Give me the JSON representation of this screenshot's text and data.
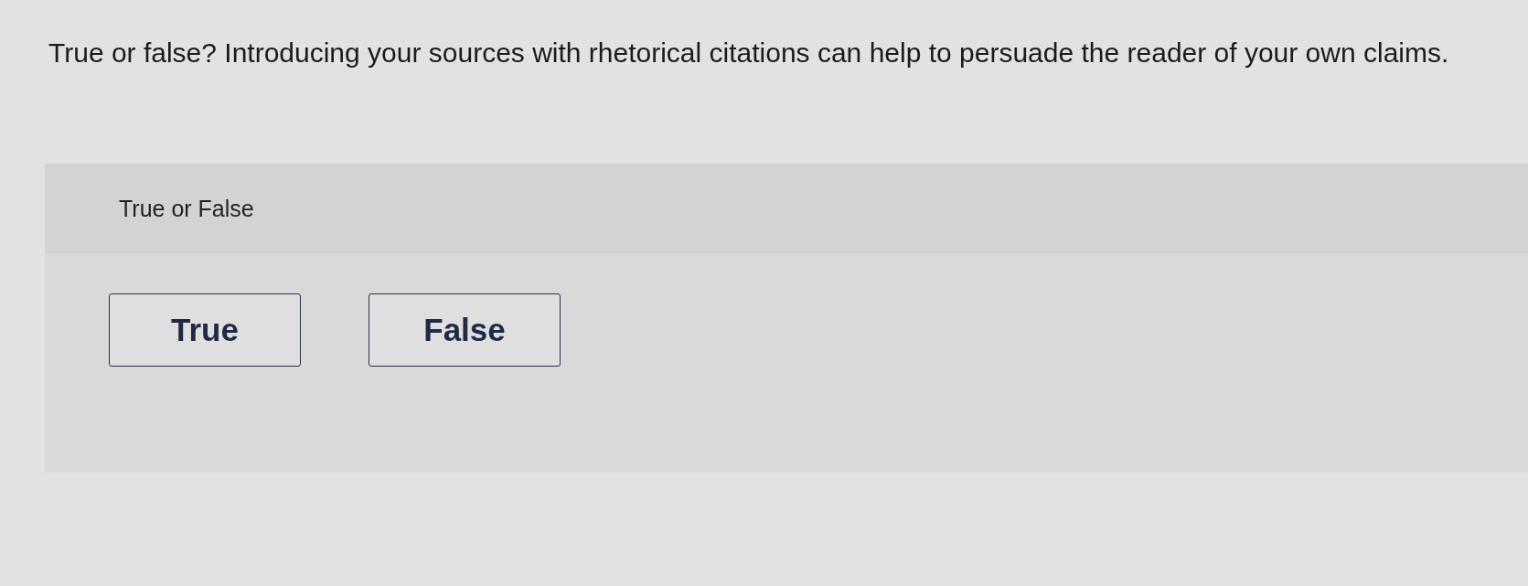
{
  "question": {
    "text": "True or false? Introducing your sources with rhetorical citations can help to persuade the reader of your own claims."
  },
  "answer_panel": {
    "label": "True or False",
    "options": [
      {
        "label": "True",
        "selected": false
      },
      {
        "label": "False",
        "selected": false
      }
    ]
  }
}
